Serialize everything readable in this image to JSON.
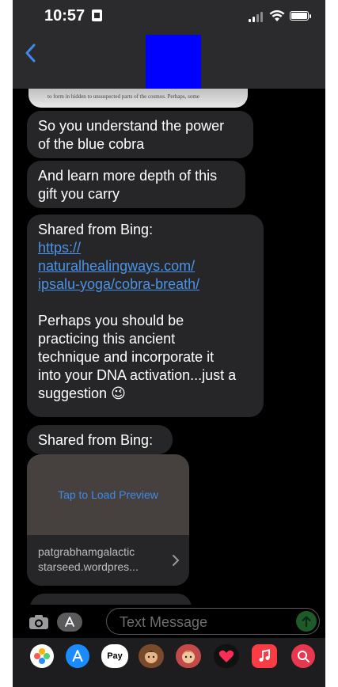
{
  "status_bar": {
    "time": "10:57"
  },
  "header": {
    "contact_avatar_color": "#0000ff"
  },
  "messages": [
    {
      "lines": [
        "So you understand the power",
        "of the blue cobra"
      ]
    },
    {
      "lines": [
        "And learn more depth of this",
        "gift you carry"
      ]
    },
    {
      "prefix": "Shared from Bing:",
      "link_lines": [
        "https://",
        "naturalhealingways.com/",
        "ipsalu-yoga/cobra-breath/"
      ],
      "body_lines": [
        "Perhaps you should be",
        "practicing this ancient",
        "technique and incorporate it",
        "into your DNA activation...just a",
        "suggestion 😉"
      ]
    },
    {
      "lines": [
        "Shared from Bing:"
      ]
    }
  ],
  "image_caption": "to form in hidden to unsuspected parts of the cosmos. Perhaps, some",
  "link_preview": {
    "load_text": "Tap to Load Preview",
    "domain_lines": [
      "patgrabhamgalactic",
      "starseed.wordpres..."
    ]
  },
  "input": {
    "placeholder": "Text Message"
  },
  "app_drawer": [
    {
      "name": "photos-app-icon"
    },
    {
      "name": "app-store-icon"
    },
    {
      "name": "apple-pay-icon",
      "label": "Pay"
    },
    {
      "name": "memoji-icon"
    },
    {
      "name": "memoji-stickers-icon"
    },
    {
      "name": "digital-touch-icon"
    },
    {
      "name": "music-app-icon"
    },
    {
      "name": "images-search-icon"
    }
  ],
  "colors": {
    "header_bg": "#2b2b2d",
    "bubble_bg": "#262628",
    "link": "#4a93e8",
    "accent_blue": "#3d8ae8"
  }
}
